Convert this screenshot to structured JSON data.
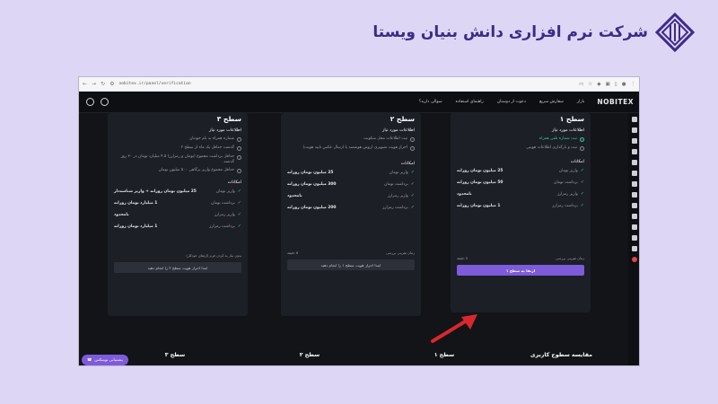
{
  "brand": {
    "name": "شرکت نرم افزاری دانش بنیان ویستا"
  },
  "browser": {
    "url": "nobitex.ir/panel/verification"
  },
  "site": {
    "logo": "NOBITEX",
    "nav": [
      "بازار",
      "سفارش سریع",
      "دعوت از دوستان",
      "راهنمای استفاده",
      "سوالی دارید؟"
    ]
  },
  "levels": [
    {
      "title": "سطح ۱",
      "req_title": "اطلاعات مورد نیاز",
      "requirements": [
        {
          "text": "ثبت شماره تلفن همراه",
          "done": true
        },
        {
          "text": "ثبت و بارگذاری اطلاعات هویتی",
          "done": false
        }
      ],
      "cap_title": "امکانات",
      "capabilities": [
        {
          "label": "واریز تومان",
          "value": "25 میلیون تومان روزانه"
        },
        {
          "label": "برداشت تومان",
          "value": "50 میلیون تومان روزانه"
        },
        {
          "label": "واریز رمزارز",
          "value": "نامحدود"
        },
        {
          "label": "برداشت رمزارز",
          "value": "1 میلیون تومان روزانه"
        }
      ],
      "foot_left": "5 دقیقه",
      "foot_right": "زمان تقریبی بررسی",
      "cta": "ارتقا به سطح ۱"
    },
    {
      "title": "سطح ۲",
      "req_title": "اطلاعات مورد نیاز",
      "requirements": [
        {
          "text": "ثبت اطلاعات محل سکونت",
          "done": false
        },
        {
          "text": "احراز هویت تصویری (روش هوشمند یا ارسال عکس تایید هویت)",
          "done": false
        }
      ],
      "cap_title": "امکانات",
      "capabilities": [
        {
          "label": "واریز تومان",
          "value": "25 میلیون تومان روزانه"
        },
        {
          "label": "برداشت تومان",
          "value": "300 میلیون تومان روزانه"
        },
        {
          "label": "واریز رمزارز",
          "value": "نامحدود"
        },
        {
          "label": "برداشت رمزارز",
          "value": "200 میلیون تومان روزانه"
        }
      ],
      "foot_left": "6 دقیقه",
      "foot_right": "زمان تقریبی بررسی",
      "cta": "ابتدا احراز هویت سطح ۱ را انجام دهید"
    },
    {
      "title": "سطح ۳",
      "req_title": "اطلاعات مورد نیاز",
      "requirements": [
        {
          "text": "شماره همراه به نام خودتان",
          "done": false
        },
        {
          "text": "گذشت حداقل یک ماه از سطح ۲",
          "done": false
        },
        {
          "text": "حداقل برداشت مجموع (تومان و رمزارز) ۴.۵ میلیارد تومان در ۳۰ روز گذشته",
          "done": false
        },
        {
          "text": "حداقل مجموع واریز ترگاهی ۵۰۰ میلیون تومان",
          "done": false
        }
      ],
      "cap_title": "امکانات",
      "capabilities": [
        {
          "label": "واریز تومان",
          "value": "25 میلیون تومان روزانه + واریز شناسه‌دار"
        },
        {
          "label": "برداشت تومان",
          "value": "1 میلیارد تومان روزانه"
        },
        {
          "label": "واریز رمزارز",
          "value": "نامحدود"
        },
        {
          "label": "برداشت رمزارز",
          "value": "1 میلیارد تومان روزانه"
        }
      ],
      "foot_left": "",
      "foot_right": "بدون نیاز به کردن فرم (ارتقای خودکار)",
      "cta": "ابتدا احراز هویت سطح ۲ را انجام دهید"
    }
  ],
  "compare": {
    "title": "مقایسه سطوح کاربری",
    "cols": [
      "سطح ۱",
      "سطح ۲",
      "سطح ۳"
    ]
  },
  "support": {
    "label": "پشتیبانی نوبیتکس"
  },
  "colors": {
    "accent": "#7d5bdb",
    "success": "#3fc79e",
    "bg": "#121418",
    "card": "#1c1f26",
    "annotation_arrow": "#d9272e"
  }
}
